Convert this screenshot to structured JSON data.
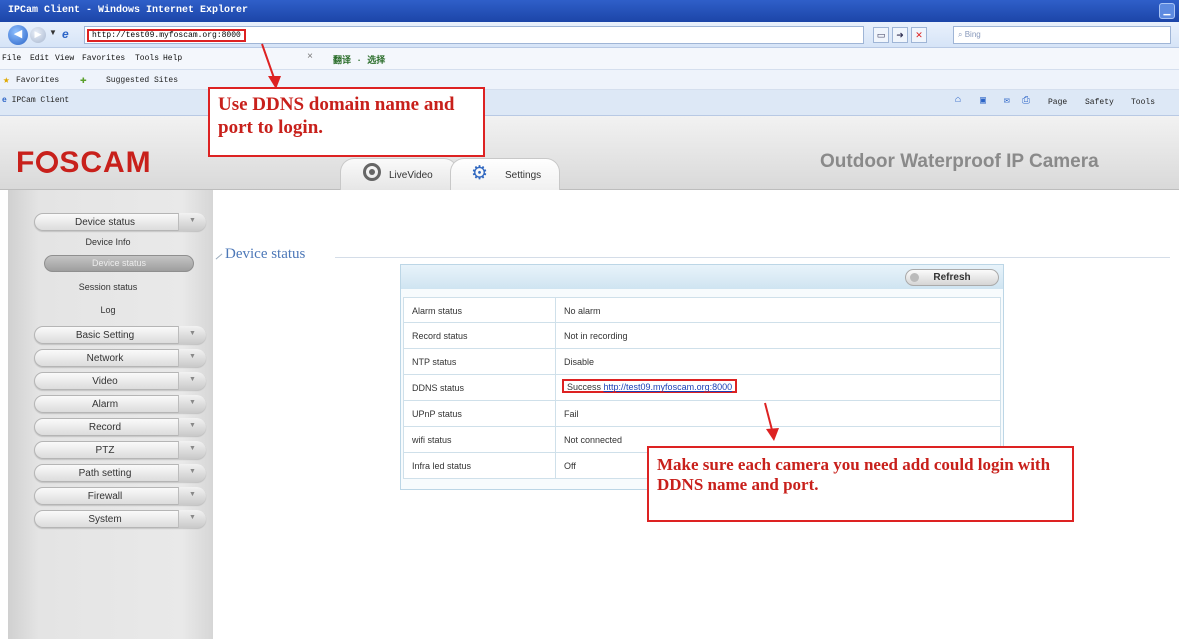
{
  "browser": {
    "window_title": "IPCam Client - Windows Internet Explorer",
    "address_url": "http://test09.myfoscam.org:8000",
    "search_placeholder": "Bing",
    "menu": [
      "File",
      "Edit",
      "View",
      "Favorites",
      "Tools",
      "Help"
    ],
    "translate_label": "翻译 · 选择",
    "favorites_label": "Favorites",
    "suggested_sites_label": "Suggested Sites",
    "tab_title": "IPCam Client",
    "command_bar": [
      "Page",
      "Safety",
      "Tools"
    ]
  },
  "header": {
    "logo": "FOSCAM",
    "title": "Outdoor Waterproof IP Camera",
    "tabs": {
      "live": "LiveVideo",
      "settings": "Settings"
    }
  },
  "sidebar": {
    "sections": {
      "device_status": "Device status",
      "basic_setting": "Basic Setting",
      "network": "Network",
      "video": "Video",
      "alarm": "Alarm",
      "record": "Record",
      "ptz": "PTZ",
      "path_setting": "Path setting",
      "firewall": "Firewall",
      "system": "System"
    },
    "sub": {
      "device_info": "Device Info",
      "device_status": "Device status",
      "session_status": "Session status",
      "log": "Log"
    }
  },
  "content": {
    "section_title": "Device status",
    "refresh_label": "Refresh",
    "rows": [
      {
        "key": "Alarm status",
        "value": "No alarm"
      },
      {
        "key": "Record status",
        "value": "Not in recording"
      },
      {
        "key": "NTP status",
        "value": "Disable"
      },
      {
        "key": "DDNS status",
        "value_prefix": "Success",
        "value_link": "http://test09.myfoscam.org:8000"
      },
      {
        "key": "UPnP status",
        "value": "Fail"
      },
      {
        "key": "wifi status",
        "value": "Not connected"
      },
      {
        "key": "Infra led status",
        "value": "Off"
      }
    ]
  },
  "annotations": {
    "top": "Use DDNS domain name and port to login.",
    "bottom": "Make sure each camera you need add could login with DDNS name and port."
  },
  "colors": {
    "brand_red": "#c8201b",
    "annotation_red": "#dd2222",
    "section_blue": "#4d78b8"
  }
}
